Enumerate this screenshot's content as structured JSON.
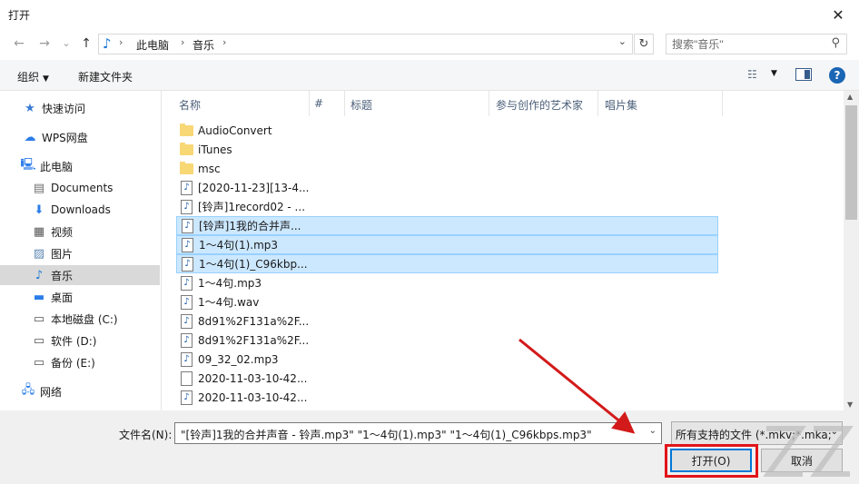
{
  "window": {
    "title": "打开",
    "close_glyph": "✕"
  },
  "nav": {
    "back_glyph": "←",
    "forward_glyph": "→",
    "recent_glyph": "⌄",
    "up_glyph": "↑",
    "breadcrumb": [
      "此电脑",
      "音乐"
    ],
    "crumb_sep": "›",
    "refresh_glyph": "↻",
    "search_placeholder": "搜索\"音乐\""
  },
  "toolbar": {
    "organize": "组织",
    "new_folder": "新建文件夹",
    "help": "?"
  },
  "sidebar": {
    "items": [
      {
        "label": "快速访问",
        "icon": "star-icon",
        "glyph": "★",
        "color": "#3a7bd5"
      },
      {
        "label": "WPS网盘",
        "icon": "cloud-icon",
        "glyph": "☁",
        "color": "#2b7de9"
      },
      {
        "label": "此电脑",
        "icon": "computer-icon",
        "glyph": "🖳",
        "color": "#2b7de9"
      },
      {
        "label": "Documents",
        "icon": "documents-icon",
        "glyph": "▤",
        "color": "#6d6d6d"
      },
      {
        "label": "Downloads",
        "icon": "downloads-icon",
        "glyph": "⬇",
        "color": "#2b7de9"
      },
      {
        "label": "视频",
        "icon": "video-icon",
        "glyph": "▦",
        "color": "#555555"
      },
      {
        "label": "图片",
        "icon": "pictures-icon",
        "glyph": "▨",
        "color": "#5d88b3"
      },
      {
        "label": "音乐",
        "icon": "music-icon",
        "glyph": "♪",
        "color": "#1e78d7"
      },
      {
        "label": "桌面",
        "icon": "desktop-icon",
        "glyph": "▬",
        "color": "#2b7de9"
      },
      {
        "label": "本地磁盘 (C:)",
        "icon": "drive-c-icon",
        "glyph": "▭",
        "color": "#555555"
      },
      {
        "label": "软件 (D:)",
        "icon": "drive-d-icon",
        "glyph": "▭",
        "color": "#555555"
      },
      {
        "label": "备份 (E:)",
        "icon": "drive-e-icon",
        "glyph": "▭",
        "color": "#555555"
      },
      {
        "label": "网络",
        "icon": "network-icon",
        "glyph": "🖧",
        "color": "#2b7de9"
      }
    ],
    "selected": "音乐"
  },
  "columns": [
    "名称",
    "#",
    "标题",
    "参与创作的艺术家",
    "唱片集"
  ],
  "files": [
    {
      "name": "AudioConvert",
      "type": "folder",
      "selected": false
    },
    {
      "name": "iTunes",
      "type": "folder",
      "selected": false
    },
    {
      "name": "msc",
      "type": "folder",
      "selected": false
    },
    {
      "name": "[2020-11-23][13-4...",
      "type": "audio",
      "selected": false
    },
    {
      "name": "[铃声]1record02 - ...",
      "type": "audio",
      "selected": false
    },
    {
      "name": "[铃声]1我的合并声...",
      "type": "audio",
      "selected": true
    },
    {
      "name": "1～4句(1).mp3",
      "type": "audio",
      "selected": true
    },
    {
      "name": "1～4句(1)_C96kbp...",
      "type": "audio",
      "selected": true
    },
    {
      "name": "1～4句.mp3",
      "type": "audio",
      "selected": false
    },
    {
      "name": "1～4句.wav",
      "type": "audio",
      "selected": false
    },
    {
      "name": "8d91%2F131a%2F...",
      "type": "audio",
      "selected": false
    },
    {
      "name": "8d91%2F131a%2F...",
      "type": "audio",
      "selected": false
    },
    {
      "name": "09_32_02.mp3",
      "type": "audio",
      "selected": false
    },
    {
      "name": "2020-11-03-10-42...",
      "type": "file",
      "selected": false
    },
    {
      "name": "2020-11-03-10-42...",
      "type": "audio",
      "selected": false
    }
  ],
  "bottom": {
    "filename_label": "文件名(N):",
    "filename_value": "\"[铃声]1我的合并声音 - 铃声.mp3\" \"1～4句(1).mp3\" \"1～4句(1)_C96kbps.mp3\"",
    "filetype_value": "所有支持的文件 (*.mkv;*.mka;",
    "open_button": "打开(O)",
    "cancel_button": "取消"
  },
  "colors": {
    "accent": "#0078d7",
    "selection": "#cce8ff",
    "annotation": "#e1141a"
  }
}
